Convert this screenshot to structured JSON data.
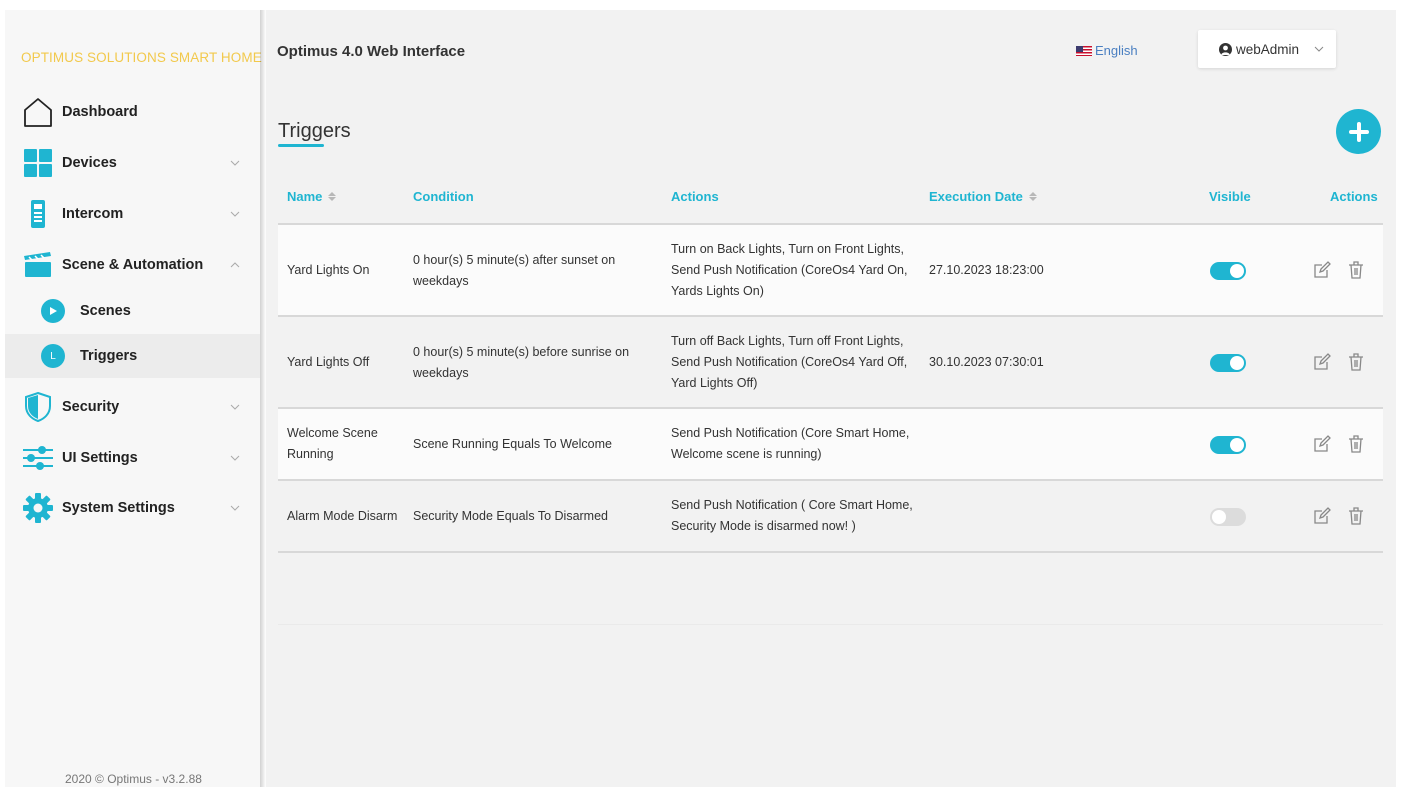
{
  "sidebar": {
    "brand": "OPTIMUS SOLUTIONS SMART HOME",
    "items": [
      {
        "label": "Dashboard",
        "icon": "house-icon"
      },
      {
        "label": "Devices",
        "icon": "grid-icon"
      },
      {
        "label": "Intercom",
        "icon": "intercom-icon"
      },
      {
        "label": "Scene & Automation",
        "icon": "clapperboard-icon"
      },
      {
        "label": "Security",
        "icon": "shield-icon"
      },
      {
        "label": "UI Settings",
        "icon": "sliders-icon"
      },
      {
        "label": "System Settings",
        "icon": "gear-icon"
      }
    ],
    "subitems": [
      {
        "label": "Scenes",
        "icon": "play-icon"
      },
      {
        "label": "Triggers",
        "icon": "trigger-icon",
        "glyph": "L"
      }
    ],
    "footer": "2020 © Optimus - v3.2.88"
  },
  "header": {
    "title": "Optimus 4.0 Web Interface",
    "language": "English",
    "user": "webAdmin"
  },
  "page": {
    "title": "Triggers"
  },
  "table": {
    "headers": {
      "name": "Name",
      "condition": "Condition",
      "actions": "Actions",
      "execution_date": "Execution Date",
      "visible": "Visible",
      "row_actions": "Actions"
    },
    "rows": [
      {
        "name": "Yard Lights On",
        "condition": "0 hour(s) 5 minute(s) after sunset on weekdays",
        "actions": "Turn on Back Lights, Turn on Front Lights, Send Push Notification (CoreOs4 Yard On, Yards Lights On)",
        "execution_date": "27.10.2023 18:23:00",
        "visible": true
      },
      {
        "name": "Yard Lights Off",
        "condition": "0 hour(s) 5 minute(s) before sunrise on weekdays",
        "actions": "Turn off Back Lights, Turn off Front Lights, Send Push Notification (CoreOs4 Yard Off, Yard Lights Off)",
        "execution_date": "30.10.2023 07:30:01",
        "visible": true
      },
      {
        "name": "Welcome Scene Running",
        "condition": "Scene Running Equals To Welcome",
        "actions": "Send Push Notification (Core Smart Home, Welcome scene is running)",
        "execution_date": "",
        "visible": true
      },
      {
        "name": "Alarm Mode Disarm",
        "condition": "Security Mode Equals To Disarmed",
        "actions": "Send Push Notification ( Core Smart Home, Security Mode is disarmed now! )",
        "execution_date": "",
        "visible": false
      }
    ]
  },
  "colors": {
    "accent": "#1fb5d1",
    "brand": "#f2c94c",
    "sidebar_bg": "#f7f7f7",
    "main_bg": "#f2f2f2"
  }
}
